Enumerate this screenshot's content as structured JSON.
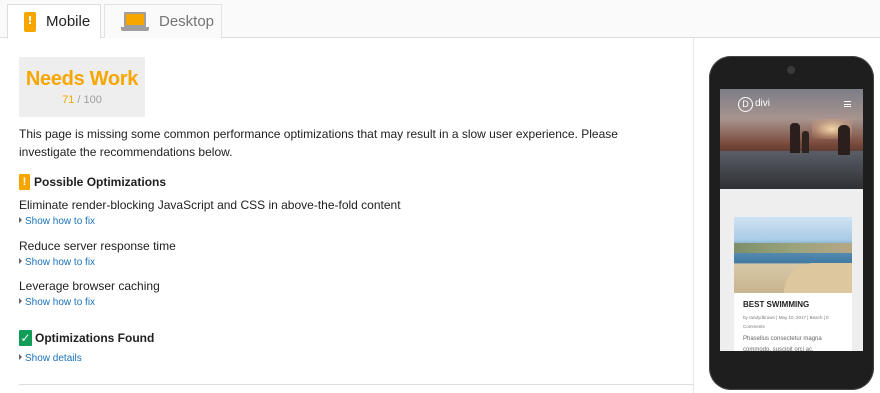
{
  "tabs": [
    {
      "label": "Mobile",
      "active": true,
      "icon": "mobile-warning-icon"
    },
    {
      "label": "Desktop",
      "active": false,
      "icon": "desktop-icon"
    }
  ],
  "score": {
    "title": "Needs Work",
    "value": "71",
    "max": "/ 100",
    "value_fraction": 0.71,
    "color": "#f7a600"
  },
  "summary": "This page is missing some common performance optimizations that may result in a slow user experience. Please investigate the recommendations below.",
  "possible": {
    "heading": "Possible Optimizations",
    "badge": "!",
    "items": [
      {
        "title": "Eliminate render-blocking JavaScript and CSS in above-the-fold content",
        "link": "Show how to fix"
      },
      {
        "title": "Reduce server response time",
        "link": "Show how to fix"
      },
      {
        "title": "Leverage browser caching",
        "link": "Show how to fix"
      }
    ]
  },
  "found": {
    "heading": "Optimizations Found",
    "badge": "✓",
    "link": "Show details"
  },
  "preview": {
    "logo_letter": "D",
    "logo_text": "divi",
    "menu_icon": "hamburger-icon",
    "post_title": "BEST SWIMMING",
    "post_meta": "by randydbrown | May 10, 2017 | Beach | 0 Comments",
    "post_excerpt": "Phasellus consectetur magna commodo, suscipit orci ac,"
  },
  "colors": {
    "warning": "#f7a600",
    "success": "#0f9d58",
    "link": "#1a73b8"
  }
}
